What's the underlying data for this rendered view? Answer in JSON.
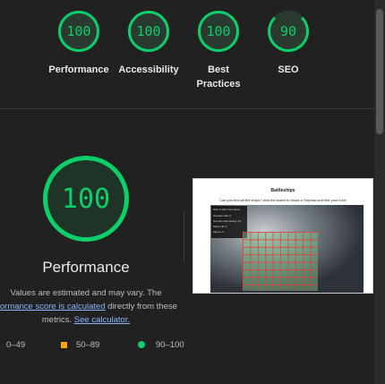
{
  "scores": [
    {
      "value": "100",
      "label": "Performance"
    },
    {
      "value": "100",
      "label": "Accessibility"
    },
    {
      "value": "100",
      "label": "Best Practices"
    },
    {
      "value": "90",
      "label": "SEO"
    }
  ],
  "performance": {
    "score": "100",
    "title": "Performance",
    "note_prefix": "Values are estimated and may vary. The",
    "note_link": "rformance score is calculated",
    "note_mid": "directly from these metrics.",
    "calc_link": "See calculator."
  },
  "legend": {
    "low": "0–49",
    "mid": "50–89",
    "high": "90–100"
  },
  "preview": {
    "title": "Battleships",
    "subtitle": "Can you find all the ships? click the board to shoot a Torpedo and test your luck!",
    "panel_lines": [
      "Who Is Win The Game",
      "Torpedo Hits: 0",
      "Torpedo Remaining: 44",
      "Ships Hit: 0",
      "Moves: 0"
    ]
  },
  "colors": {
    "pass": "#0cce6b",
    "average": "#ffa400",
    "fail": "#ff4e42"
  }
}
